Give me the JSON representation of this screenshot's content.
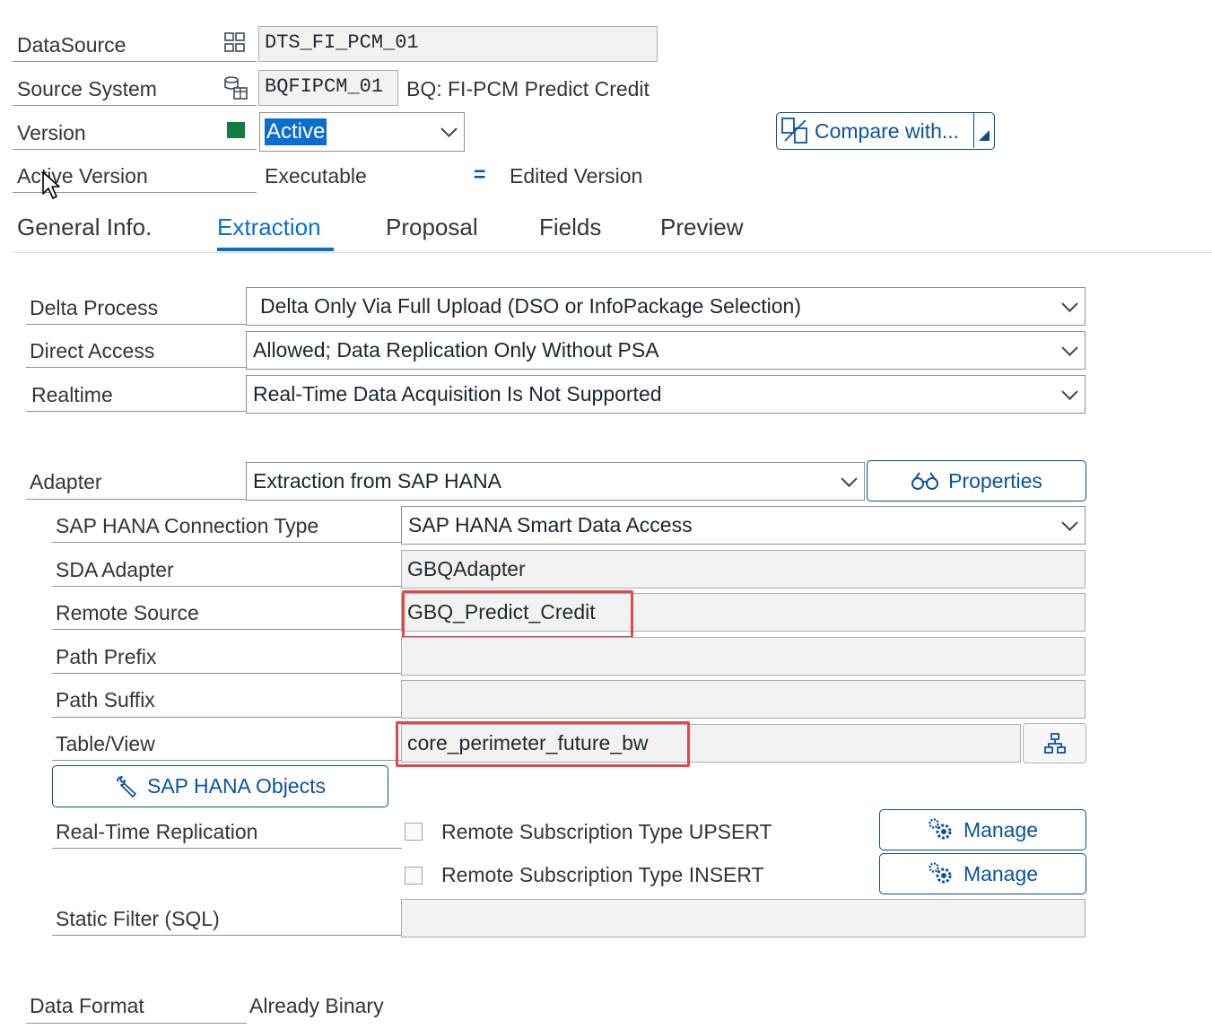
{
  "header": {
    "datasource": {
      "label": "DataSource",
      "value": "DTS_FI_PCM_01",
      "icon": "datasource-icon"
    },
    "source_system": {
      "label": "Source System",
      "value": "BQFIPCM_01",
      "description": "BQ: FI-PCM Predict Credit",
      "icon": "source-system-icon"
    },
    "version": {
      "label": "Version",
      "value": "Active",
      "status_color": "#107e3e"
    },
    "active_version": {
      "label": "Active Version",
      "value": "Executable",
      "equals": "=",
      "edited": "Edited Version"
    },
    "compare_button": "Compare with..."
  },
  "tabs": [
    {
      "label": "General Info.",
      "active": false
    },
    {
      "label": "Extraction",
      "active": true
    },
    {
      "label": "Proposal",
      "active": false
    },
    {
      "label": "Fields",
      "active": false
    },
    {
      "label": "Preview",
      "active": false
    }
  ],
  "extraction": {
    "delta_process": {
      "label": "Delta Process",
      "value": "Delta Only Via Full Upload (DSO or InfoPackage Selection)"
    },
    "direct_access": {
      "label": "Direct Access",
      "value": "Allowed; Data Replication Only Without PSA"
    },
    "realtime": {
      "label": "Realtime",
      "value": "Real-Time Data Acquisition Is Not Supported"
    },
    "adapter": {
      "label": "Adapter",
      "value": "Extraction from SAP HANA",
      "properties_button": "Properties"
    },
    "hana_connection_type": {
      "label": "SAP HANA Connection Type",
      "value": "SAP HANA Smart Data Access"
    },
    "sda_adapter": {
      "label": "SDA Adapter",
      "value": "GBQAdapter"
    },
    "remote_source": {
      "label": "Remote Source",
      "value": "GBQ_Predict_Credit"
    },
    "path_prefix": {
      "label": "Path Prefix",
      "value": ""
    },
    "path_suffix": {
      "label": "Path Suffix",
      "value": ""
    },
    "table_view": {
      "label": "Table/View",
      "value": "core_perimeter_future_bw"
    },
    "hana_objects_button": "SAP HANA Objects",
    "real_time_replication": {
      "label": "Real-Time Replication",
      "upsert": {
        "label": "Remote Subscription Type UPSERT",
        "checked": false,
        "button": "Manage"
      },
      "insert": {
        "label": "Remote Subscription Type INSERT",
        "checked": false,
        "button": "Manage"
      }
    },
    "static_filter": {
      "label": "Static Filter (SQL)",
      "value": ""
    },
    "data_format": {
      "label": "Data Format",
      "value": "Already Binary"
    }
  },
  "colors": {
    "accent": "#0a6ed1",
    "highlight_box": "#e04848",
    "active_status": "#107e3e"
  }
}
